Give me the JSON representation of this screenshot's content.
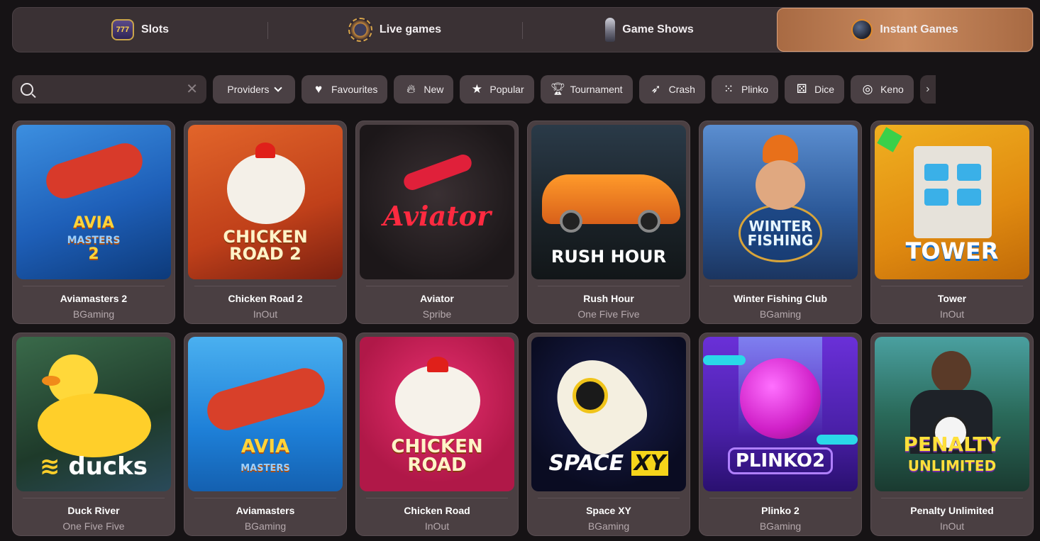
{
  "categories": [
    {
      "label": "Slots",
      "icon": "slot-machine-icon",
      "active": false
    },
    {
      "label": "Live games",
      "icon": "poker-chip-icon",
      "active": false
    },
    {
      "label": "Game Shows",
      "icon": "microphone-icon",
      "active": false
    },
    {
      "label": "Instant Games",
      "icon": "bomb-icon",
      "active": true
    }
  ],
  "search": {
    "placeholder": "",
    "value": ""
  },
  "filters": {
    "providers": "Providers",
    "chips": [
      {
        "label": "Favourites",
        "icon": "heart-icon"
      },
      {
        "label": "New",
        "icon": "fire-icon"
      },
      {
        "label": "Popular",
        "icon": "star-icon"
      },
      {
        "label": "Tournament",
        "icon": "trophy-icon"
      },
      {
        "label": "Crash",
        "icon": "rocket-icon"
      },
      {
        "label": "Plinko",
        "icon": "dots-grid-icon"
      },
      {
        "label": "Dice",
        "icon": "dice-icon"
      },
      {
        "label": "Keno",
        "icon": "target-icon"
      }
    ]
  },
  "games": [
    {
      "title": "Aviamasters 2",
      "provider": "BGaming",
      "logo": "AVIA\nMASTERS\n2"
    },
    {
      "title": "Chicken Road 2",
      "provider": "InOut",
      "logo": "CHICKEN\nROAD 2"
    },
    {
      "title": "Aviator",
      "provider": "Spribe",
      "logo": "Aviator"
    },
    {
      "title": "Rush Hour",
      "provider": "One Five Five",
      "logo": "RUSH HOUR"
    },
    {
      "title": "Winter Fishing Club",
      "provider": "BGaming",
      "logo": "WINTER\nFISHING"
    },
    {
      "title": "Tower",
      "provider": "InOut",
      "logo": "TOWER"
    },
    {
      "title": "Duck River",
      "provider": "One Five Five",
      "logo": "ducks"
    },
    {
      "title": "Aviamasters",
      "provider": "BGaming",
      "logo": "AVIA\nMASTERS"
    },
    {
      "title": "Chicken Road",
      "provider": "InOut",
      "logo": "CHICKEN\nROAD"
    },
    {
      "title": "Space XY",
      "provider": "BGaming",
      "logo": "SPACE XY"
    },
    {
      "title": "Plinko 2",
      "provider": "BGaming",
      "logo": "PLINKO2"
    },
    {
      "title": "Penalty Unlimited",
      "provider": "InOut",
      "logo": "PENALTY\nUNLIMITED"
    }
  ]
}
